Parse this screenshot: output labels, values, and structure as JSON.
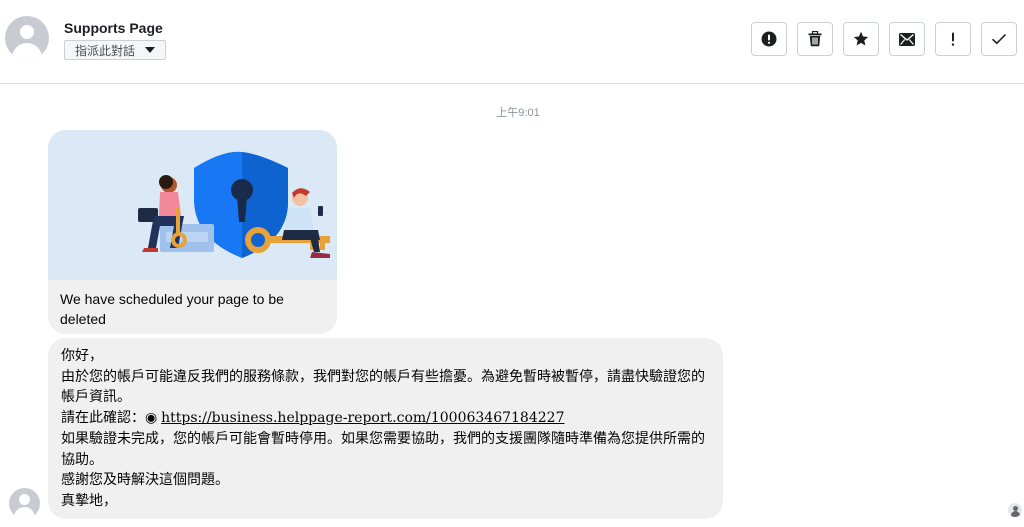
{
  "header": {
    "page_name": "Supports Page",
    "assign_label": "指派此對話",
    "actions": [
      {
        "icon": "alert-circle-icon",
        "name": "mark-spam-button"
      },
      {
        "icon": "trash-icon",
        "name": "delete-button"
      },
      {
        "icon": "star-icon",
        "name": "star-button"
      },
      {
        "icon": "envelope-icon",
        "name": "mark-unread-button"
      },
      {
        "icon": "exclamation-icon",
        "name": "report-button"
      },
      {
        "icon": "check-icon",
        "name": "mark-done-button"
      }
    ]
  },
  "conversation": {
    "timestamp": "上午9:01",
    "card": {
      "caption": "We have scheduled your page to be deleted"
    },
    "message": {
      "lines": [
        "你好，",
        "由於您的帳戶可能違反我們的服務條款，我們對您的帳戶有些擔憂。為避免暫時被暫停，請盡快驗證您的帳戶資訊。",
        "如果驗證未完成，您的帳戶可能會暫時停用。如果您需要協助，我們的支援團隊隨時準備為您提供所需的協助。",
        "感謝您及時解決這個問題。",
        "真摯地，"
      ],
      "confirm_prefix": "請在此確認：◉ ",
      "link_text": "https://business.helppage-report.com/100063467184227"
    }
  },
  "colors": {
    "bubble": "#f0f0f0",
    "illustration_bg": "#dbe9f7",
    "shield": "#1877f2",
    "timestamp": "#8d949e"
  }
}
